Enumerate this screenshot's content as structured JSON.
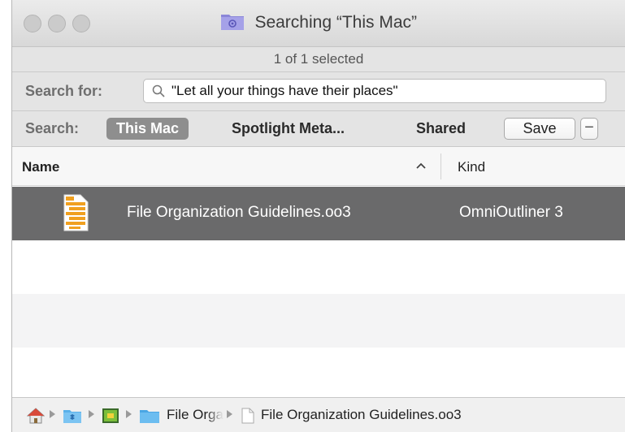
{
  "window": {
    "title": "Searching “This Mac”",
    "status": "1 of 1 selected"
  },
  "search_for": {
    "label": "Search for:",
    "value": "\"Let all your things have their places\""
  },
  "scope": {
    "label": "Search:",
    "options": [
      "This Mac",
      "Spotlight Meta...",
      "Shared"
    ],
    "selected": "This Mac",
    "save_label": "Save",
    "minus_label": "−"
  },
  "columns": {
    "name": "Name",
    "kind": "Kind",
    "sort": "ascending"
  },
  "results": [
    {
      "name": "File Organization Guidelines.oo3",
      "kind": "OmniOutliner 3",
      "icon": "omnioutliner-document-icon",
      "selected": true
    }
  ],
  "path_bar": {
    "segments": [
      {
        "icon": "home-icon",
        "label": ""
      },
      {
        "icon": "dropbox-folder-icon",
        "label": ""
      },
      {
        "icon": "app-folder-icon",
        "label": ""
      },
      {
        "icon": "folder-icon",
        "label": "File Orga"
      },
      {
        "icon": "document-icon",
        "label": "File Organization Guidelines.oo3"
      }
    ]
  },
  "colors": {
    "selection": "#6a6a6b",
    "scope_active": "#8e8e8e",
    "folder": "#5ab1ea",
    "accent_purple": "#8a86d8",
    "file_icon_orange": "#f0a020"
  }
}
